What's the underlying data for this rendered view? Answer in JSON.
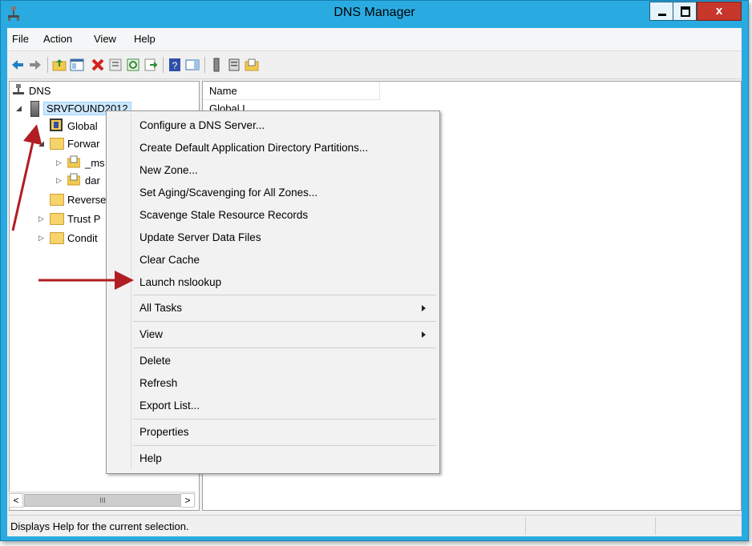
{
  "window": {
    "title": "DNS Manager",
    "close_glyph": "x"
  },
  "menubar": [
    "File",
    "Action",
    "View",
    "Help"
  ],
  "toolbar_icons": [
    "back-arrow-icon",
    "forward-arrow-icon",
    "up-folder-icon",
    "show-hide-tree-icon",
    "delete-icon",
    "properties-icon",
    "refresh-icon",
    "export-list-icon",
    "help-icon",
    "show-hide-action-pane-icon",
    "server-icon",
    "record-icon",
    "zone-icon"
  ],
  "tree": {
    "root": "DNS",
    "server": "SRVFOUND2012",
    "items": [
      "Global",
      "Forwar",
      "_ms",
      "dar",
      "Reverse",
      "Trust P",
      "Condit"
    ]
  },
  "list": {
    "column": "Name",
    "first_row": "Global L"
  },
  "scrollbar": {
    "left": "<",
    "right": ">",
    "grip": "III"
  },
  "status": {
    "text": "Displays Help for the current selection."
  },
  "context_menu": {
    "items": [
      "Configure a DNS Server...",
      "Create Default Application Directory Partitions...",
      "New Zone...",
      "Set Aging/Scavenging for All Zones...",
      "Scavenge Stale Resource Records",
      "Update Server Data Files",
      "Clear Cache",
      "Launch nslookup",
      "All Tasks",
      "View",
      "Delete",
      "Refresh",
      "Export List...",
      "Properties",
      "Help"
    ]
  },
  "colors": {
    "title_bar": "#29abe2",
    "close_button": "#c7372c",
    "annotation_arrow": "#b11d22",
    "selection": "#cce8ff"
  }
}
